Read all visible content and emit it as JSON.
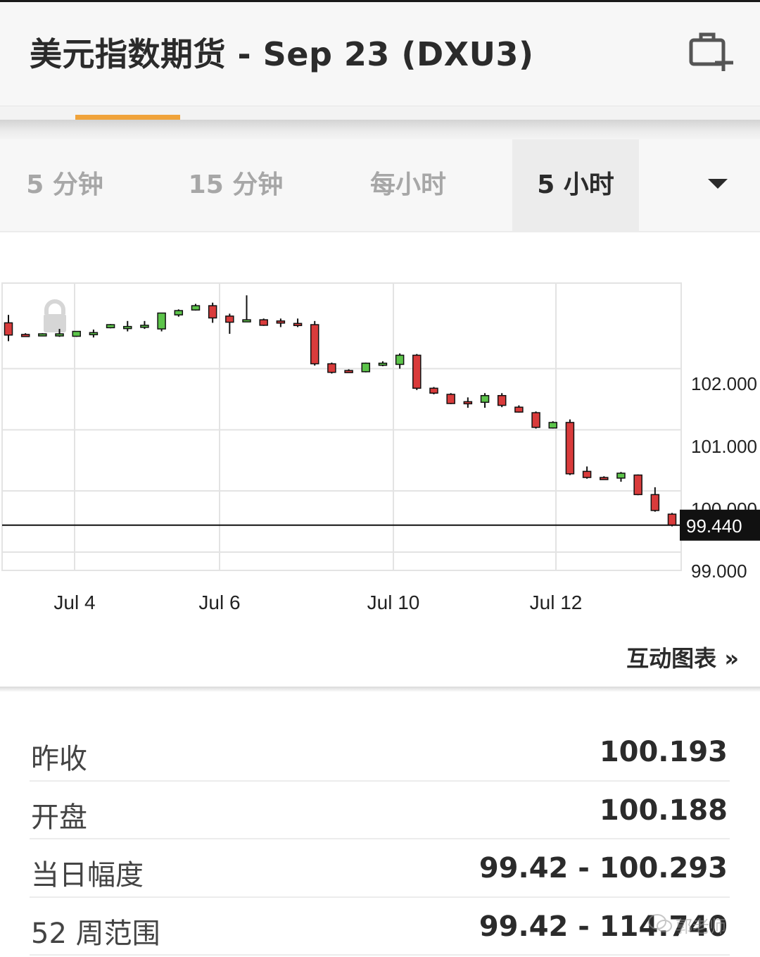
{
  "header": {
    "title": "美元指数期货 - Sep 23 (DXU3)",
    "add_icon": "portfolio-add-icon"
  },
  "timeframe_tabs": {
    "items": [
      {
        "label": "5 分钟",
        "active": false
      },
      {
        "label": "15 分钟",
        "active": false
      },
      {
        "label": "每小时",
        "active": false
      },
      {
        "label": "5 小时",
        "active": true
      }
    ],
    "dropdown_icon": "caret-down-icon"
  },
  "chart_data": {
    "type": "candlestick",
    "x_tick_labels": [
      "Jul 4",
      "Jul 6",
      "Jul 10",
      "Jul 12"
    ],
    "y_tick_labels": [
      "102.000",
      "101.000",
      "100.000",
      "99.000"
    ],
    "y_ticks": [
      102,
      101,
      100,
      99
    ],
    "ylim": [
      98.7,
      103.4
    ],
    "last_price": 99.44,
    "last_price_label": "99.440",
    "grid": true,
    "candles": [
      {
        "o": 102.75,
        "h": 102.88,
        "l": 102.45,
        "c": 102.55
      },
      {
        "o": 102.56,
        "h": 102.58,
        "l": 102.52,
        "c": 102.54
      },
      {
        "o": 102.56,
        "h": 102.58,
        "l": 102.54,
        "c": 102.57
      },
      {
        "o": 102.56,
        "h": 102.65,
        "l": 102.52,
        "c": 102.57
      },
      {
        "o": 102.53,
        "h": 102.6,
        "l": 102.52,
        "c": 102.61
      },
      {
        "o": 102.58,
        "h": 102.64,
        "l": 102.51,
        "c": 102.59
      },
      {
        "o": 102.67,
        "h": 102.73,
        "l": 102.66,
        "c": 102.72
      },
      {
        "o": 102.68,
        "h": 102.78,
        "l": 102.61,
        "c": 102.69
      },
      {
        "o": 102.7,
        "h": 102.78,
        "l": 102.65,
        "c": 102.71
      },
      {
        "o": 102.65,
        "h": 102.61,
        "l": 102.61,
        "c": 102.91
      },
      {
        "o": 102.88,
        "h": 102.97,
        "l": 102.85,
        "c": 102.95
      },
      {
        "o": 102.96,
        "h": 103.06,
        "l": 102.95,
        "c": 103.03
      },
      {
        "o": 103.03,
        "h": 103.08,
        "l": 102.75,
        "c": 102.83
      },
      {
        "o": 102.86,
        "h": 102.9,
        "l": 102.57,
        "c": 102.76
      },
      {
        "o": 102.8,
        "h": 103.2,
        "l": 102.78,
        "c": 102.8
      },
      {
        "o": 102.8,
        "h": 102.82,
        "l": 102.7,
        "c": 102.71
      },
      {
        "o": 102.78,
        "h": 102.82,
        "l": 102.68,
        "c": 102.75
      },
      {
        "o": 102.74,
        "h": 102.82,
        "l": 102.68,
        "c": 102.73
      },
      {
        "o": 102.72,
        "h": 102.78,
        "l": 102.05,
        "c": 102.08
      },
      {
        "o": 102.08,
        "h": 102.1,
        "l": 101.92,
        "c": 101.94
      },
      {
        "o": 101.97,
        "h": 101.99,
        "l": 101.95,
        "c": 101.96
      },
      {
        "o": 101.95,
        "h": 102.1,
        "l": 101.94,
        "c": 102.09
      },
      {
        "o": 102.07,
        "h": 102.12,
        "l": 102.04,
        "c": 102.09
      },
      {
        "o": 102.07,
        "h": 102.25,
        "l": 102.0,
        "c": 102.22
      },
      {
        "o": 102.22,
        "h": 102.24,
        "l": 101.65,
        "c": 101.68
      },
      {
        "o": 101.68,
        "h": 101.7,
        "l": 101.58,
        "c": 101.6
      },
      {
        "o": 101.58,
        "h": 101.6,
        "l": 101.42,
        "c": 101.43
      },
      {
        "o": 101.46,
        "h": 101.53,
        "l": 101.36,
        "c": 101.45
      },
      {
        "o": 101.45,
        "h": 101.6,
        "l": 101.36,
        "c": 101.56
      },
      {
        "o": 101.56,
        "h": 101.6,
        "l": 101.37,
        "c": 101.4
      },
      {
        "o": 101.37,
        "h": 101.4,
        "l": 101.28,
        "c": 101.29
      },
      {
        "o": 101.28,
        "h": 101.3,
        "l": 101.02,
        "c": 101.04
      },
      {
        "o": 101.03,
        "h": 101.14,
        "l": 101.02,
        "c": 101.12
      },
      {
        "o": 101.12,
        "h": 101.17,
        "l": 100.26,
        "c": 100.28
      },
      {
        "o": 100.32,
        "h": 100.4,
        "l": 100.2,
        "c": 100.22
      },
      {
        "o": 100.22,
        "h": 100.24,
        "l": 100.18,
        "c": 100.2
      },
      {
        "o": 100.21,
        "h": 100.31,
        "l": 100.15,
        "c": 100.29
      },
      {
        "o": 100.26,
        "h": 100.27,
        "l": 99.93,
        "c": 99.94
      },
      {
        "o": 99.94,
        "h": 100.06,
        "l": 99.66,
        "c": 99.68
      },
      {
        "o": 99.62,
        "h": 99.64,
        "l": 99.42,
        "c": 99.44
      }
    ],
    "colors": {
      "up": "#5cc44a",
      "down": "#d93b3b",
      "grid": "#e3e3e3",
      "price_line": "#111111",
      "price_tag_bg": "#111111"
    },
    "lock_icon": "lock-icon"
  },
  "interactive_chart_link": "互动图表 »",
  "stats": [
    {
      "label": "昨收",
      "value": "100.193"
    },
    {
      "label": "开盘",
      "value": "100.188"
    },
    {
      "label": "当日幅度",
      "value": "99.42 - 100.293"
    },
    {
      "label": "52 周范围",
      "value": "99.42 - 114.740"
    }
  ],
  "watermark": {
    "icon": "wechat-icon",
    "text": "郭老师"
  }
}
